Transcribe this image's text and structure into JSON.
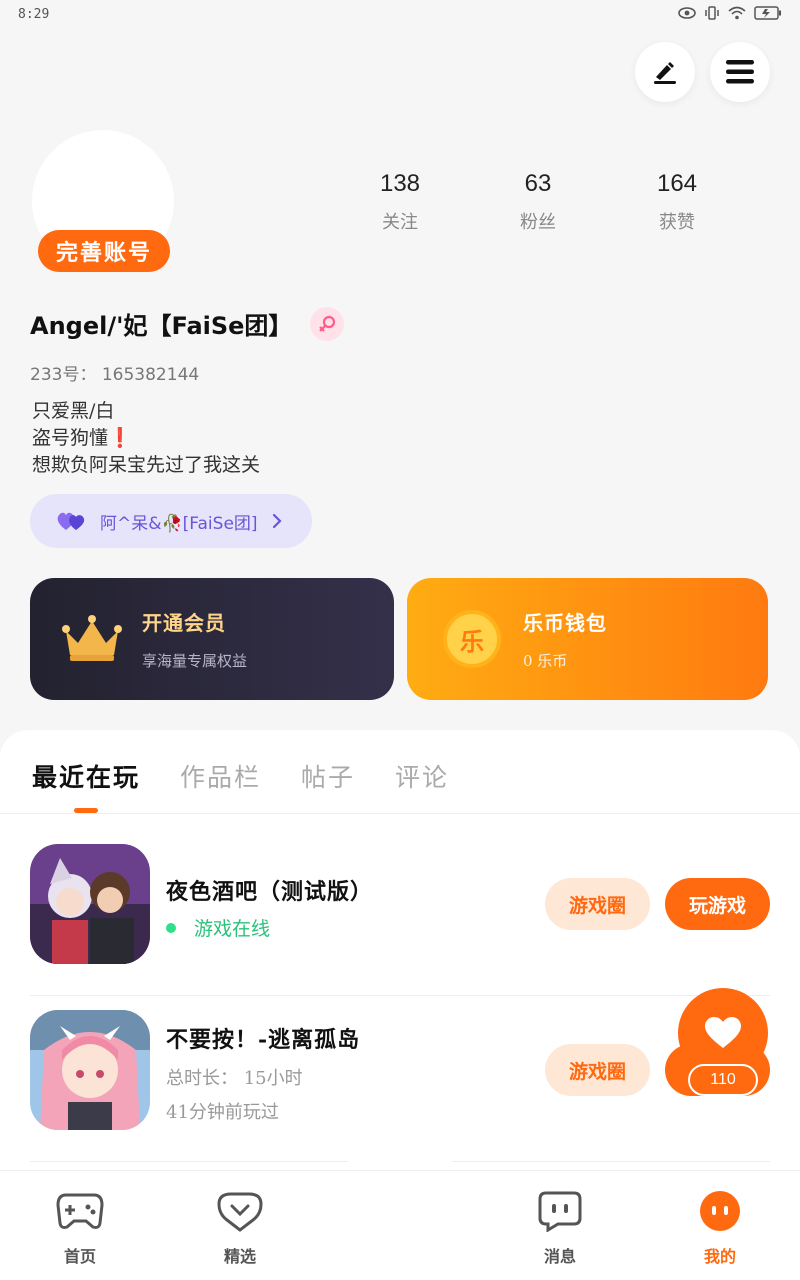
{
  "status_bar": {
    "time": "8:29"
  },
  "profile": {
    "complete_badge": "完善账号",
    "stats": [
      {
        "num": "138",
        "label": "关注"
      },
      {
        "num": "63",
        "label": "粉丝"
      },
      {
        "num": "164",
        "label": "获赞"
      }
    ],
    "username": "Angel/'妃【FaiSe团】",
    "uid": "233号： 165382144",
    "bio_lines": [
      "只爱黑/白",
      "盗号狗懂❗",
      "想欺负阿呆宝先过了我这关"
    ],
    "group_name": "阿^呆&🥀[FaiSe团]"
  },
  "cards": {
    "vip": {
      "title": "开通会员",
      "sub": "享海量专属权益"
    },
    "wallet": {
      "title": "乐币钱包",
      "sub": "0 乐币",
      "coin_char": "乐"
    }
  },
  "tabs": [
    "最近在玩",
    "作品栏",
    "帖子",
    "评论"
  ],
  "games": [
    {
      "name": "夜色酒吧（测试版）",
      "status": "游戏在线",
      "circle_label": "游戏圈",
      "play_label": "玩游戏"
    },
    {
      "name": "不要按！-逃离孤岛",
      "duration": "总时长： 15小时",
      "last_played": "41分钟前玩过",
      "circle_label": "游戏圈"
    }
  ],
  "float_like": {
    "count": "110"
  },
  "bottom_nav": [
    {
      "label": "首页",
      "icon": "gamepad-icon"
    },
    {
      "label": "精选",
      "icon": "heart-chat-icon"
    },
    {
      "label": "消息",
      "icon": "message-icon"
    },
    {
      "label": "我的",
      "icon": "profile-face-icon"
    }
  ],
  "colors": {
    "accent": "#ff6a10",
    "vip_gold": "#ffd58a",
    "online_green": "#29c37a",
    "group_purple": "#6a54d8"
  }
}
